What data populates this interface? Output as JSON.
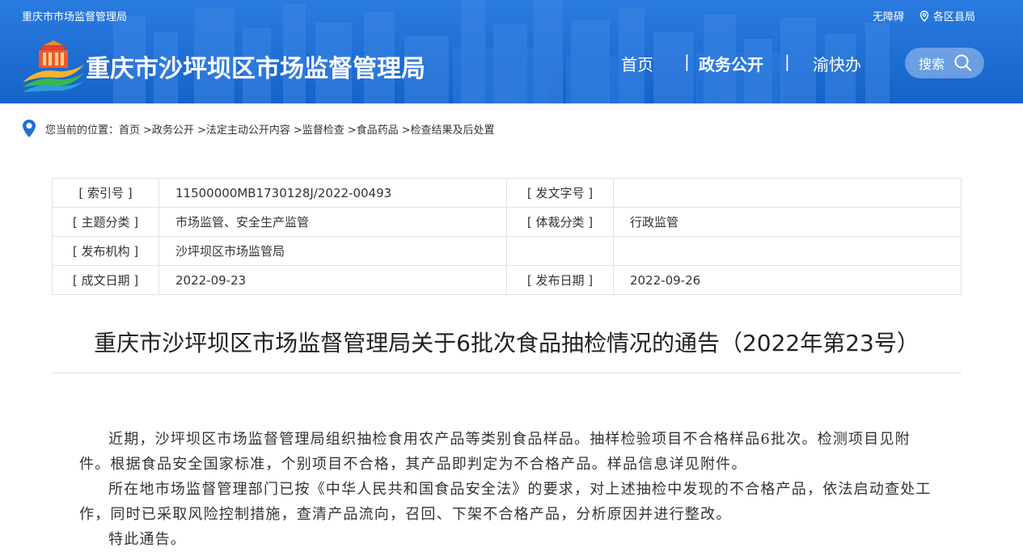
{
  "header": {
    "top_site_link": "重庆市市场监督管理局",
    "accessibility_link": "无障碍",
    "district_link": "各区县局",
    "site_title": "重庆市沙坪坝区市场监督管理局",
    "nav": {
      "home": "首页",
      "separator": "|",
      "gov_affairs": "政务公开",
      "yukuaiban": "渝快办"
    },
    "search_label": "搜索",
    "brand_color": "#1f6fd6"
  },
  "breadcrumb": {
    "prefix": "您当前的位置：",
    "items": [
      "首页",
      ">政务公开",
      ">法定主动公开内容",
      ">监督检查",
      ">食品药品",
      ">检查结果及后处置"
    ]
  },
  "info_table": {
    "rows": [
      {
        "label1": "[ 索引号 ]",
        "value1": "11500000MB1730128J/2022-00493",
        "label2": "[ 发文字号 ]",
        "value2": ""
      },
      {
        "label1": "[ 主题分类 ]",
        "value1": "市场监管、安全生产监管",
        "label2": "[ 体裁分类 ]",
        "value2": "行政监管"
      },
      {
        "label1": "[ 发布机构 ]",
        "value1": "沙坪坝区市场监管局",
        "label2": "",
        "value2": ""
      },
      {
        "label1": "[ 成文日期 ]",
        "value1": "2022-09-23",
        "label2": "[ 发布日期 ]",
        "value2": "2022-09-26"
      }
    ]
  },
  "article": {
    "title": "重庆市沙坪坝区市场监督管理局关于6批次食品抽检情况的通告（2022年第23号）",
    "paragraphs": [
      "近期，沙坪坝区市场监督管理局组织抽检食用农产品等类别食品样品。抽样检验项目不合格样品6批次。检测项目见附件。根据食品安全国家标准，个别项目不合格，其产品即判定为不合格产品。样品信息详见附件。",
      "所在地市场监督管理部门已按《中华人民共和国食品安全法》的要求，对上述抽检中发现的不合格产品，依法启动查处工作，同时已采取风险控制措施，查清产品流向，召回、下架不合格产品，分析原因并进行整改。",
      "特此通告。"
    ]
  },
  "icons": {
    "location": "location-pin-icon",
    "search": "search-icon",
    "district": "location-outline-icon",
    "logo": "emblem-logo"
  }
}
